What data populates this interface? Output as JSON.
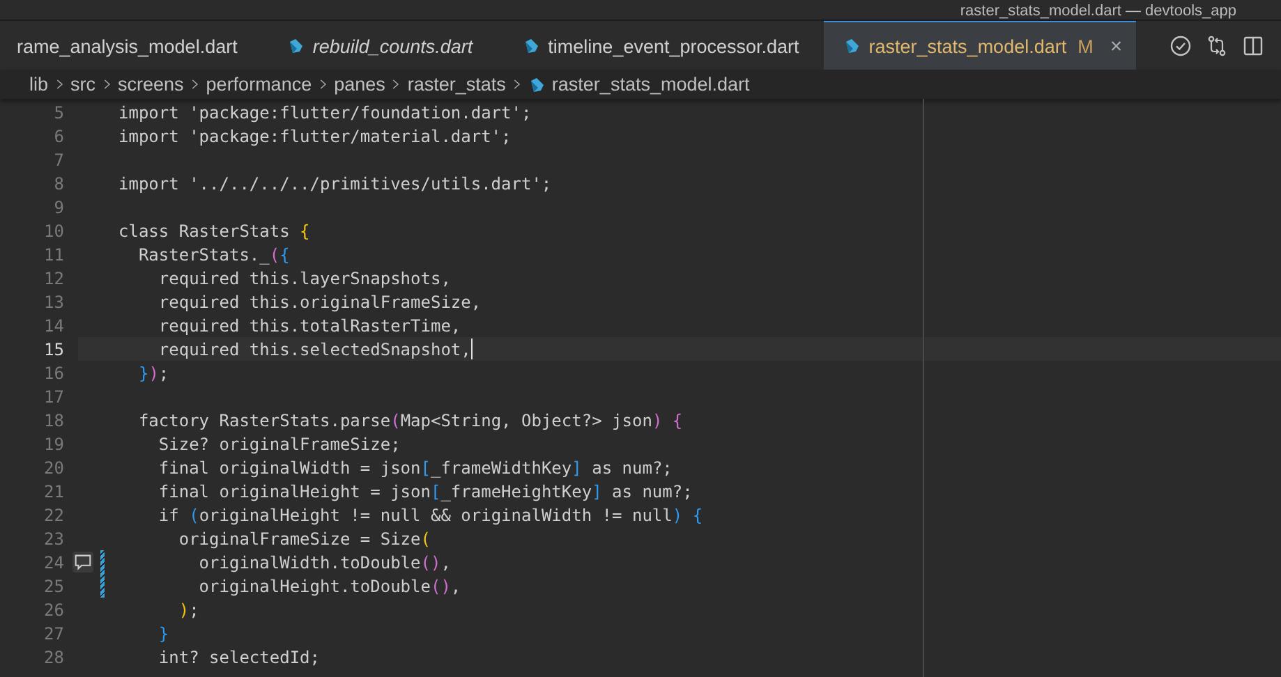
{
  "window": {
    "title": "raster_stats_model.dart — devtools_app"
  },
  "tabs": [
    {
      "label": "rame_analysis_model.dart",
      "selected": false,
      "preview": false,
      "has_icon": false
    },
    {
      "label": "rebuild_counts.dart",
      "selected": false,
      "preview": true,
      "has_icon": true
    },
    {
      "label": "timeline_event_processor.dart",
      "selected": false,
      "preview": false,
      "has_icon": true
    },
    {
      "label": "raster_stats_model.dart",
      "selected": true,
      "preview": false,
      "has_icon": true,
      "badge": "M",
      "close": "×"
    }
  ],
  "breadcrumb": [
    "lib",
    "src",
    "screens",
    "performance",
    "panes",
    "raster_stats",
    "raster_stats_model.dart"
  ],
  "lines": [
    {
      "number": "5",
      "current": false,
      "changed": false,
      "comment": false,
      "segments": [
        {
          "kind": "text",
          "t": "import 'package:flutter/foundation.dart';"
        }
      ]
    },
    {
      "number": "6",
      "current": false,
      "changed": false,
      "comment": false,
      "segments": [
        {
          "kind": "text",
          "t": "import 'package:flutter/material.dart';"
        }
      ]
    },
    {
      "number": "7",
      "current": false,
      "changed": false,
      "comment": false
    },
    {
      "number": "8",
      "current": false,
      "changed": false,
      "comment": false,
      "segments": [
        {
          "kind": "text",
          "t": "import '../../../../primitives/utils.dart';"
        }
      ]
    },
    {
      "number": "9",
      "current": false,
      "changed": false,
      "comment": false
    },
    {
      "number": "10",
      "current": false,
      "changed": false,
      "comment": false,
      "segments": [
        {
          "kind": "text",
          "t": "class RasterStats "
        },
        {
          "kind": "gold",
          "t": "{"
        }
      ]
    },
    {
      "number": "11",
      "current": false,
      "changed": false,
      "comment": false,
      "segments": [
        {
          "kind": "text",
          "t": "  RasterStats._"
        },
        {
          "kind": "pink",
          "t": "("
        },
        {
          "kind": "blue",
          "t": "{"
        }
      ]
    },
    {
      "number": "12",
      "current": false,
      "changed": false,
      "comment": false,
      "segments": [
        {
          "kind": "text",
          "t": "    required this.layerSnapshots,"
        }
      ]
    },
    {
      "number": "13",
      "current": false,
      "changed": false,
      "comment": false,
      "segments": [
        {
          "kind": "text",
          "t": "    required this.originalFrameSize,"
        }
      ]
    },
    {
      "number": "14",
      "current": false,
      "changed": false,
      "comment": false,
      "segments": [
        {
          "kind": "text",
          "t": "    required this.totalRasterTime,"
        }
      ]
    },
    {
      "number": "15",
      "current": true,
      "changed": false,
      "comment": false,
      "segments": [
        {
          "kind": "text",
          "t": "    required this.selectedSnapshot,"
        }
      ]
    },
    {
      "number": "16",
      "current": false,
      "changed": false,
      "comment": false,
      "segments": [
        {
          "kind": "blue",
          "t": "  }"
        },
        {
          "kind": "pink",
          "t": ")"
        },
        {
          "kind": "text",
          "t": ";"
        }
      ]
    },
    {
      "number": "17",
      "current": false,
      "changed": false,
      "comment": false
    },
    {
      "number": "18",
      "current": false,
      "changed": false,
      "comment": false,
      "segments": [
        {
          "kind": "text",
          "t": "  factory RasterStats.parse"
        },
        {
          "kind": "pink",
          "t": "("
        },
        {
          "kind": "text",
          "t": "Map<String, Object?> json"
        },
        {
          "kind": "pink",
          "t": ")"
        },
        {
          "kind": "pink",
          "t": " {"
        }
      ]
    },
    {
      "number": "19",
      "current": false,
      "changed": false,
      "comment": false,
      "segments": [
        {
          "kind": "text",
          "t": "    Size? originalFrameSize;"
        }
      ]
    },
    {
      "number": "20",
      "current": false,
      "changed": false,
      "comment": false,
      "segments": [
        {
          "kind": "text",
          "t": "    final originalWidth = json"
        },
        {
          "kind": "blue",
          "t": "["
        },
        {
          "kind": "text",
          "t": "_frameWidthKey"
        },
        {
          "kind": "blue",
          "t": "]"
        },
        {
          "kind": "text",
          "t": " as num?;"
        }
      ]
    },
    {
      "number": "21",
      "current": false,
      "changed": false,
      "comment": false,
      "segments": [
        {
          "kind": "text",
          "t": "    final originalHeight = json"
        },
        {
          "kind": "blue",
          "t": "["
        },
        {
          "kind": "text",
          "t": "_frameHeightKey"
        },
        {
          "kind": "blue",
          "t": "]"
        },
        {
          "kind": "text",
          "t": " as num?;"
        }
      ]
    },
    {
      "number": "22",
      "current": false,
      "changed": false,
      "comment": false,
      "segments": [
        {
          "kind": "text",
          "t": "    if "
        },
        {
          "kind": "blue",
          "t": "("
        },
        {
          "kind": "text",
          "t": "originalHeight != null && originalWidth != null"
        },
        {
          "kind": "blue",
          "t": ")"
        },
        {
          "kind": "blue",
          "t": " {"
        }
      ]
    },
    {
      "number": "23",
      "current": false,
      "changed": false,
      "comment": false,
      "segments": [
        {
          "kind": "text",
          "t": "      originalFrameSize = Size"
        },
        {
          "kind": "gold",
          "t": "("
        }
      ]
    },
    {
      "number": "24",
      "current": false,
      "changed": true,
      "comment": true,
      "segments": [
        {
          "kind": "text",
          "t": "        originalWidth.toDouble"
        },
        {
          "kind": "pink",
          "t": "()"
        },
        {
          "kind": "text",
          "t": ","
        }
      ]
    },
    {
      "number": "25",
      "current": false,
      "changed": true,
      "comment": false,
      "segments": [
        {
          "kind": "text",
          "t": "        originalHeight.toDouble"
        },
        {
          "kind": "pink",
          "t": "()"
        },
        {
          "kind": "text",
          "t": ","
        }
      ]
    },
    {
      "number": "26",
      "current": false,
      "changed": false,
      "comment": false,
      "segments": [
        {
          "kind": "gold",
          "t": "      )"
        },
        {
          "kind": "text",
          "t": ";"
        }
      ]
    },
    {
      "number": "27",
      "current": false,
      "changed": false,
      "comment": false,
      "segments": [
        {
          "kind": "blue",
          "t": "    }"
        }
      ]
    },
    {
      "number": "28",
      "current": false,
      "changed": false,
      "comment": false,
      "segments": [
        {
          "kind": "text",
          "t": "    int? selectedId;"
        }
      ]
    }
  ]
}
